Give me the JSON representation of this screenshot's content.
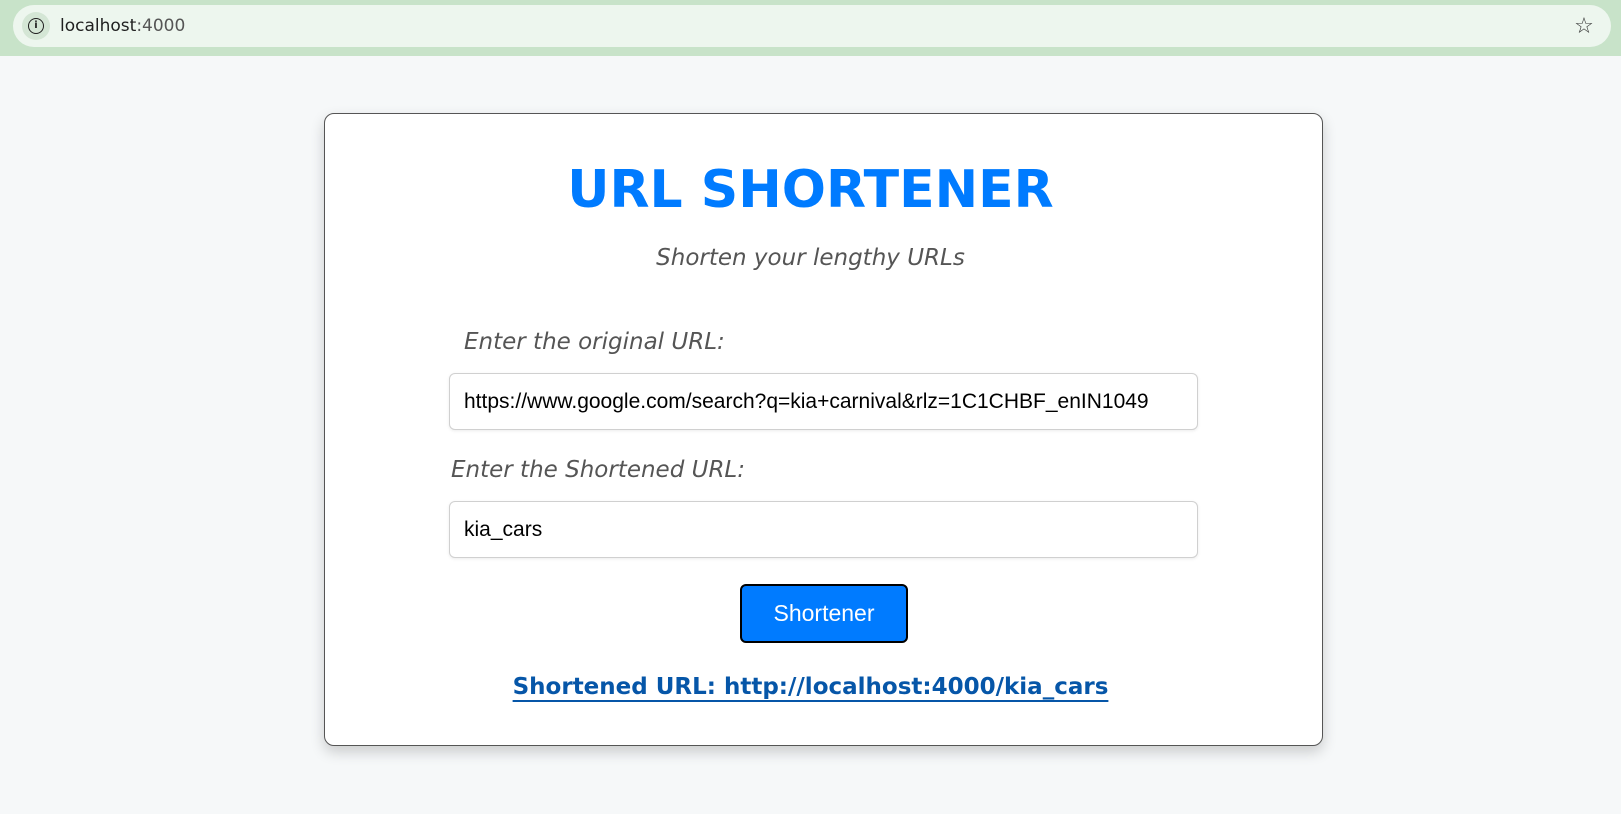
{
  "browser": {
    "url_host": "localhost",
    "url_port": ":4000",
    "info_icon_glyph": "i",
    "star_icon_glyph": "☆"
  },
  "app": {
    "title": "URL SHORTENER",
    "subtitle": "Shorten your lengthy URLs",
    "original_label": "Enter the original URL:",
    "original_value": "https://www.google.com/search?q=kia+carnival&rlz=1C1CHBF_enIN1049",
    "short_label": "Enter the Shortened URL:",
    "short_value": "kia_cars",
    "button_label": "Shortener",
    "result_text": "Shortened URL: http://localhost:4000/kia_cars",
    "accent_color": "#007bff",
    "link_color": "#0656a8"
  }
}
